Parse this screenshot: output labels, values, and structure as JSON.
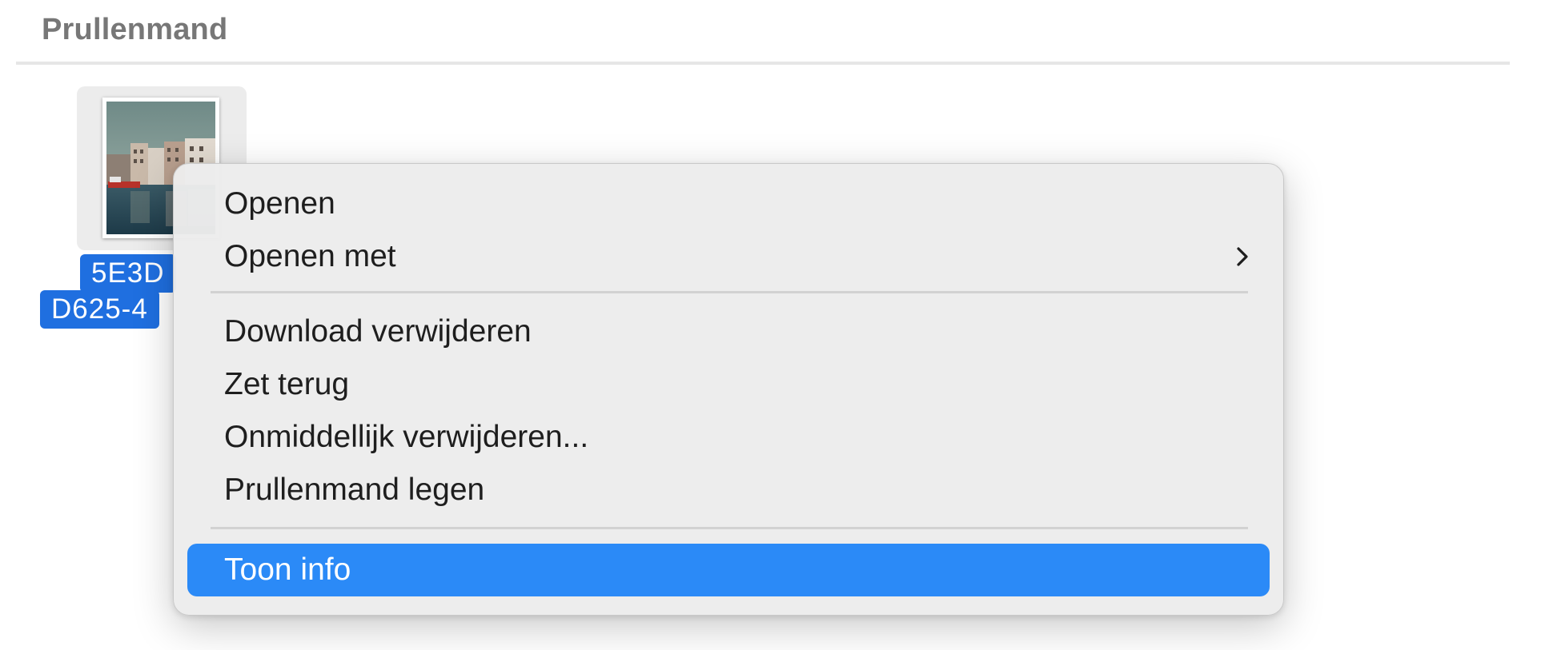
{
  "section": {
    "title": "Prullenmand"
  },
  "file": {
    "name_line1": "5E3D",
    "name_line2": "D625-4",
    "selected_color": "#1f6fe0"
  },
  "context_menu": {
    "items": [
      {
        "label": "Openen"
      },
      {
        "label": "Openen met",
        "submenu_icon": "chevron-right-icon"
      },
      {
        "label": "Download verwijderen"
      },
      {
        "label": "Zet terug"
      },
      {
        "label": "Onmiddellijk verwijderen..."
      },
      {
        "label": "Prullenmand legen"
      },
      {
        "label": "Toon info",
        "highlighted": true
      }
    ],
    "highlight_color": "#2b8af7"
  }
}
